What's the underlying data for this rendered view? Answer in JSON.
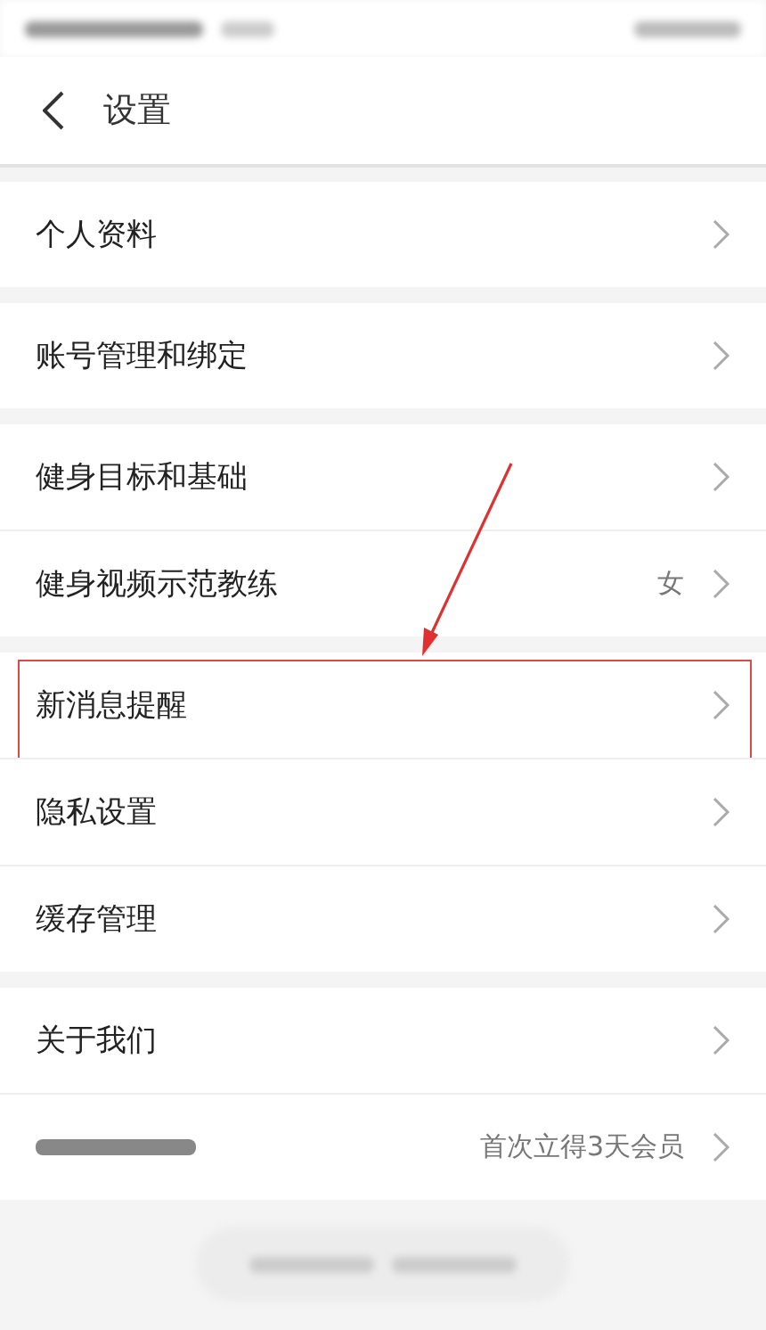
{
  "header": {
    "title": "设置"
  },
  "groups": [
    {
      "rows": [
        {
          "label": "个人资料",
          "highlighted": false
        }
      ]
    },
    {
      "rows": [
        {
          "label": "账号管理和绑定",
          "highlighted": false
        }
      ]
    },
    {
      "rows": [
        {
          "label": "健身目标和基础",
          "highlighted": false
        },
        {
          "label": "健身视频示范教练",
          "value": "女",
          "highlighted": false
        }
      ]
    },
    {
      "rows": [
        {
          "label": "新消息提醒",
          "highlighted": true
        },
        {
          "label": "隐私设置",
          "highlighted": false
        },
        {
          "label": "缓存管理",
          "highlighted": false
        }
      ]
    },
    {
      "rows": [
        {
          "label": "关于我们",
          "highlighted": false
        },
        {
          "value": "首次立得3天会员",
          "highlighted": false
        }
      ]
    }
  ]
}
